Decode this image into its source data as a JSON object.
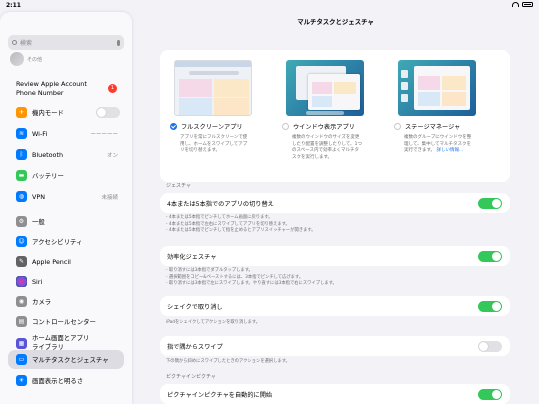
{
  "status": {
    "time": "2:11"
  },
  "sidebar": {
    "search_placeholder": "検索",
    "profile_label": "その他",
    "review": {
      "line1": "Review Apple Account",
      "line2": "Phone Number",
      "badge": "1"
    },
    "items": [
      {
        "label": "機内モード",
        "icon": "airplane-icon",
        "color": "#ff9500"
      },
      {
        "label": "Wi-Fi",
        "value": "ーーーーー",
        "icon": "wifi-icon",
        "color": "#007aff"
      },
      {
        "label": "Bluetooth",
        "value": "オン",
        "icon": "bluetooth-icon",
        "color": "#007aff"
      },
      {
        "label": "バッテリー",
        "icon": "battery-icon",
        "color": "#34c759"
      },
      {
        "label": "VPN",
        "value": "未接続",
        "icon": "vpn-icon",
        "color": "#007aff"
      },
      {
        "label": "一般",
        "icon": "gear-icon",
        "color": "#8e8e93"
      },
      {
        "label": "アクセシビリティ",
        "icon": "accessibility-icon",
        "color": "#007aff"
      },
      {
        "label": "Apple Pencil",
        "icon": "pencil-icon",
        "color": "#636366"
      },
      {
        "label": "Siri",
        "icon": "siri-icon",
        "color": "#1c1c1e"
      },
      {
        "label": "カメラ",
        "icon": "camera-icon",
        "color": "#8e8e93"
      },
      {
        "label": "コントロールセンター",
        "icon": "control-center-icon",
        "color": "#8e8e93"
      },
      {
        "label": "ホーム画面とアプリ\nライブラリ",
        "label1": "ホーム画面とアプリ",
        "label2": "ライブラリ",
        "icon": "home-screen-icon",
        "color": "#5856d6"
      },
      {
        "label": "マルチタスクとジェスチャ",
        "icon": "multitasking-icon",
        "color": "#007aff"
      },
      {
        "label": "画面表示と明るさ",
        "icon": "display-icon",
        "color": "#007aff"
      }
    ]
  },
  "main": {
    "title": "マルチタスクとジェスチャ",
    "options": [
      {
        "label": "フルスクリーンアプリ",
        "selected": true,
        "desc": "アプリを常にフルスクリーンで使用し、ホームをスワイプしてアプリを切り替えます。"
      },
      {
        "label": "ウインドウ表示アプリ",
        "selected": false,
        "desc": "複数のウインドウのサイズを変更したり配置を調整したりして、1つのスペース内で効率よくマルチタスクを実行します。"
      },
      {
        "label": "ステージマネージャ",
        "selected": false,
        "desc": "複数のグループにウインドウを整理して、集中してマルチタスクを実行できます。",
        "link": "詳しい情報..."
      }
    ],
    "gestures_header": "ジェスチャ",
    "four_five": {
      "label": "4本または5本指でのアプリの切り替え",
      "on": true,
      "notes": [
        "- 4本または5本指でピンチしてホーム画面に戻ります。",
        "- 4本または5本指で左右にスワイプしてアプリを切り替えます。",
        "- 4本または5本指でピンチして指を止めるとアプリスイッチャーが開きます。"
      ]
    },
    "efficiency": {
      "label": "効率化ジェスチャ",
      "on": true,
      "notes": [
        "- 取り消すには3本指でダブルタップします。",
        "- 選択範囲をコピー&ペーストするには、3本指でピンチして広げます。",
        "- 取り消すには3本指で左にスワイプします。やり直すには3本指で右にスワイプします。"
      ]
    },
    "shake": {
      "label": "シェイクで取り消し",
      "on": true,
      "note": "iPadをシェイクしてアクションを取り消します。"
    },
    "swipe": {
      "label": "指で隅からスワイプ",
      "on": false,
      "note": "下の隅から斜めにスワイプしたときのアクションを選択します。"
    },
    "pip_header": "ピクチャインピクチャ",
    "pip": {
      "label": "ピクチャインピクチャを自動的に開始",
      "on": true
    }
  }
}
